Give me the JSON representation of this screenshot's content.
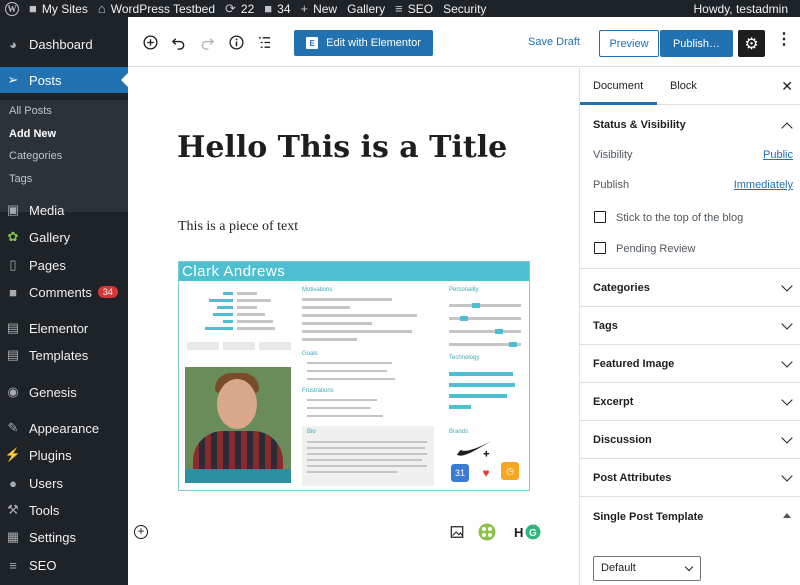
{
  "adminbar": {
    "my_sites": "My Sites",
    "site_name": "WordPress Testbed",
    "updates_count": "22",
    "comments_count": "34",
    "new_label": "New",
    "gallery_label": "Gallery",
    "seo_label": "SEO",
    "security_label": "Security",
    "howdy": "Howdy, testadmin"
  },
  "sidebar": {
    "dashboard": "Dashboard",
    "posts": "Posts",
    "all_posts": "All Posts",
    "add_new": "Add New",
    "categories": "Categories",
    "tags": "Tags",
    "media": "Media",
    "gallery": "Gallery",
    "pages": "Pages",
    "comments": "Comments",
    "comments_badge": "34",
    "elementor": "Elementor",
    "templates": "Templates",
    "genesis": "Genesis",
    "appearance": "Appearance",
    "plugins": "Plugins",
    "users": "Users",
    "tools": "Tools",
    "settings": "Settings",
    "seo": "SEO"
  },
  "toolbar": {
    "edit_elementor": "Edit with Elementor",
    "save_draft": "Save Draft",
    "preview": "Preview",
    "publish": "Publish…"
  },
  "content": {
    "title": "Hello This is a Title",
    "paragraph": "This is a piece of text",
    "persona_name": "Clark Andrews",
    "persona_sections": {
      "motivations": "Motivations",
      "personality": "Personality",
      "goals": "Goals",
      "technology": "Technology",
      "frustrations": "Frustrations",
      "bio": "Bio",
      "brands": "Brands"
    }
  },
  "panel": {
    "tab_document": "Document",
    "tab_block": "Block",
    "status_visibility": "Status & Visibility",
    "visibility_label": "Visibility",
    "visibility_value": "Public",
    "publish_label": "Publish",
    "publish_value": "Immediately",
    "stick_label": "Stick to the top of the blog",
    "pending_label": "Pending Review",
    "categories": "Categories",
    "tags": "Tags",
    "featured_image": "Featured Image",
    "excerpt": "Excerpt",
    "discussion": "Discussion",
    "post_attributes": "Post Attributes",
    "single_post_template": "Single Post Template",
    "template_value": "Default"
  },
  "colors": {
    "accent": "#2271b1",
    "sidebar_bg": "#1d2327",
    "persona_teal": "#4ebfd0"
  }
}
